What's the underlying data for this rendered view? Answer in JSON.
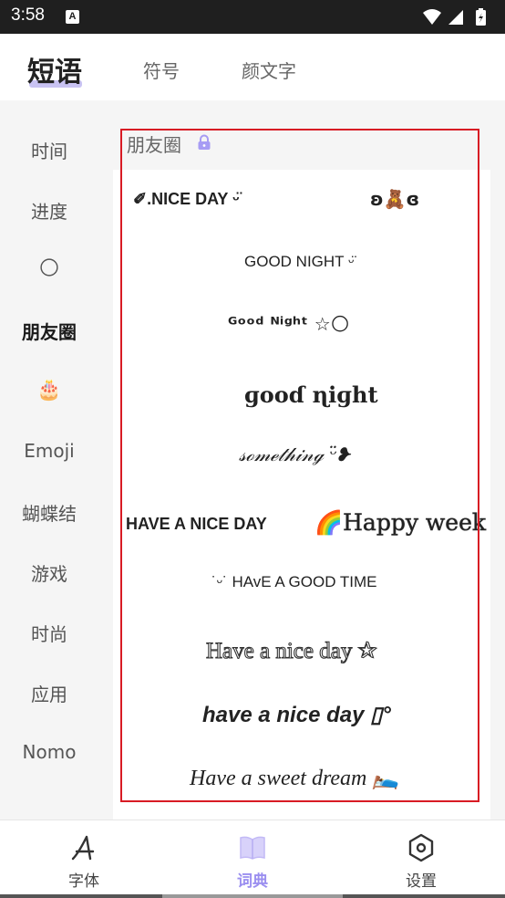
{
  "status_bar": {
    "time": "3:58",
    "app_icon_letter": "A",
    "icons": [
      "wifi-icon",
      "signal-icon",
      "battery-icon"
    ]
  },
  "top_tabs": [
    {
      "label": "短语",
      "active": true
    },
    {
      "label": "符号",
      "active": false
    },
    {
      "label": "颜文字",
      "active": false
    }
  ],
  "sidebar": {
    "items": [
      {
        "label": "时间",
        "active": false
      },
      {
        "label": "进度",
        "active": false
      },
      {
        "label": "🌕",
        "active": false
      },
      {
        "label": "朋友圈",
        "active": true
      },
      {
        "label": "🎂",
        "active": false
      },
      {
        "label": "Emoji",
        "active": false
      },
      {
        "label": "蝴蝶结",
        "active": false
      },
      {
        "label": "游戏",
        "active": false
      },
      {
        "label": "时尚",
        "active": false
      },
      {
        "label": "应用",
        "active": false
      },
      {
        "label": "Nomo",
        "active": false
      }
    ]
  },
  "section": {
    "title": "朋友圈",
    "locked": true,
    "icon": "lock-icon"
  },
  "phrases": [
    "✐.NICE DAY ᵕ̈",
    "ʚ🧸ɞ",
    "GOOD NIGHT ᵕ̈",
    "ᴳᵒᵒᵈ ᴺⁱᵍʰᵗ ☆🌕",
    "ɡooɗ ɳiɡht",
    "𝓈ℴ𝓂ℯ𝓉𝒽𝒾𝓃ℊ ᵕ̈❥",
    "HAVE A NICE DAY",
    "🌈Happy week",
    "˙ᵕ˙ HAvE A GOOD TIME",
    "Have a nice day ✰",
    "have a nice day ▯°",
    "Have a sweet dream 🛌"
  ],
  "bottom_nav": [
    {
      "label": "字体",
      "icon": "font-icon",
      "active": false
    },
    {
      "label": "词典",
      "icon": "book-icon",
      "active": true
    },
    {
      "label": "设置",
      "icon": "settings-icon",
      "active": false
    }
  ],
  "colors": {
    "accent": "#9b8ff0",
    "tab_underline": "#c9c3f3",
    "highlight": "#d81b24",
    "lock": "#a79cf4"
  }
}
